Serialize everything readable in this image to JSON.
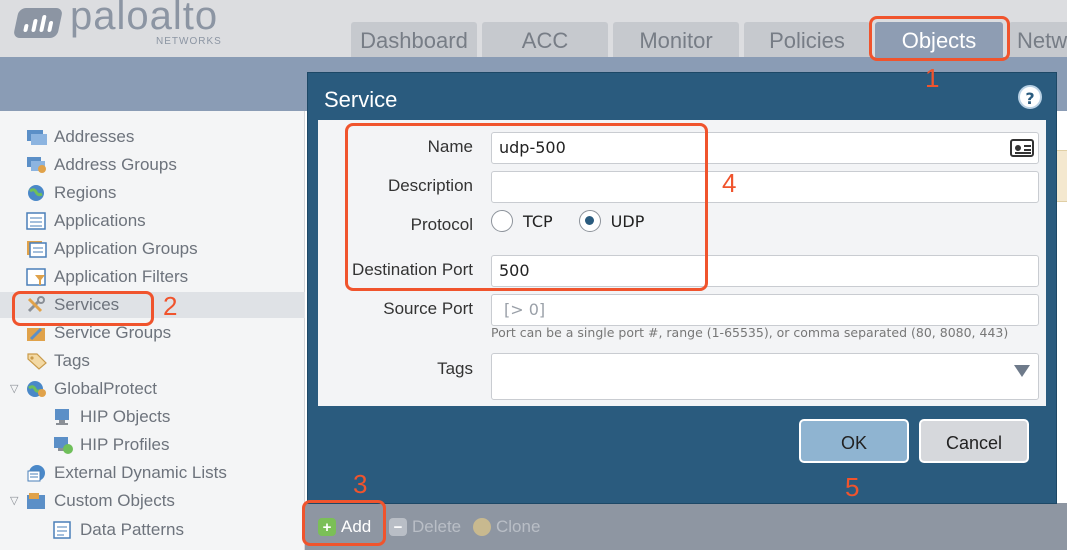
{
  "brand": {
    "name": "paloalto",
    "sub": "NETWORKS"
  },
  "tabs": [
    {
      "label": "Dashboard"
    },
    {
      "label": "ACC"
    },
    {
      "label": "Monitor"
    },
    {
      "label": "Policies"
    },
    {
      "label": "Objects"
    },
    {
      "label": "Netw"
    }
  ],
  "sidebar": {
    "items": [
      {
        "label": "Addresses"
      },
      {
        "label": "Address Groups"
      },
      {
        "label": "Regions"
      },
      {
        "label": "Applications"
      },
      {
        "label": "Application Groups"
      },
      {
        "label": "Application Filters"
      },
      {
        "label": "Services"
      },
      {
        "label": "Service Groups"
      },
      {
        "label": "Tags"
      },
      {
        "label": "GlobalProtect"
      },
      {
        "label": "HIP Objects"
      },
      {
        "label": "HIP Profiles"
      },
      {
        "label": "External Dynamic Lists"
      },
      {
        "label": "Custom Objects"
      },
      {
        "label": "Data Patterns"
      }
    ]
  },
  "dialog": {
    "title": "Service",
    "name_label": "Name",
    "name_value": "udp-500",
    "description_label": "Description",
    "description_value": "",
    "protocol_label": "Protocol",
    "protocol_options": [
      "TCP",
      "UDP"
    ],
    "protocol_selected": "UDP",
    "dest_port_label": "Destination Port",
    "dest_port_value": "500",
    "source_port_label": "Source Port",
    "source_port_placeholder": "[> 0]",
    "port_hint": "Port can be a single port #, range (1-65535), or comma separated (80, 8080, 443)",
    "tags_label": "Tags",
    "ok_label": "OK",
    "cancel_label": "Cancel"
  },
  "toolbar": {
    "add": "Add",
    "delete": "Delete",
    "clone": "Clone"
  },
  "annotations": [
    "1",
    "2",
    "3",
    "4",
    "5"
  ],
  "colors": {
    "annotation": "#f0542d",
    "dialog": "#2a5b7e",
    "active_tab": "#8e9db3"
  }
}
